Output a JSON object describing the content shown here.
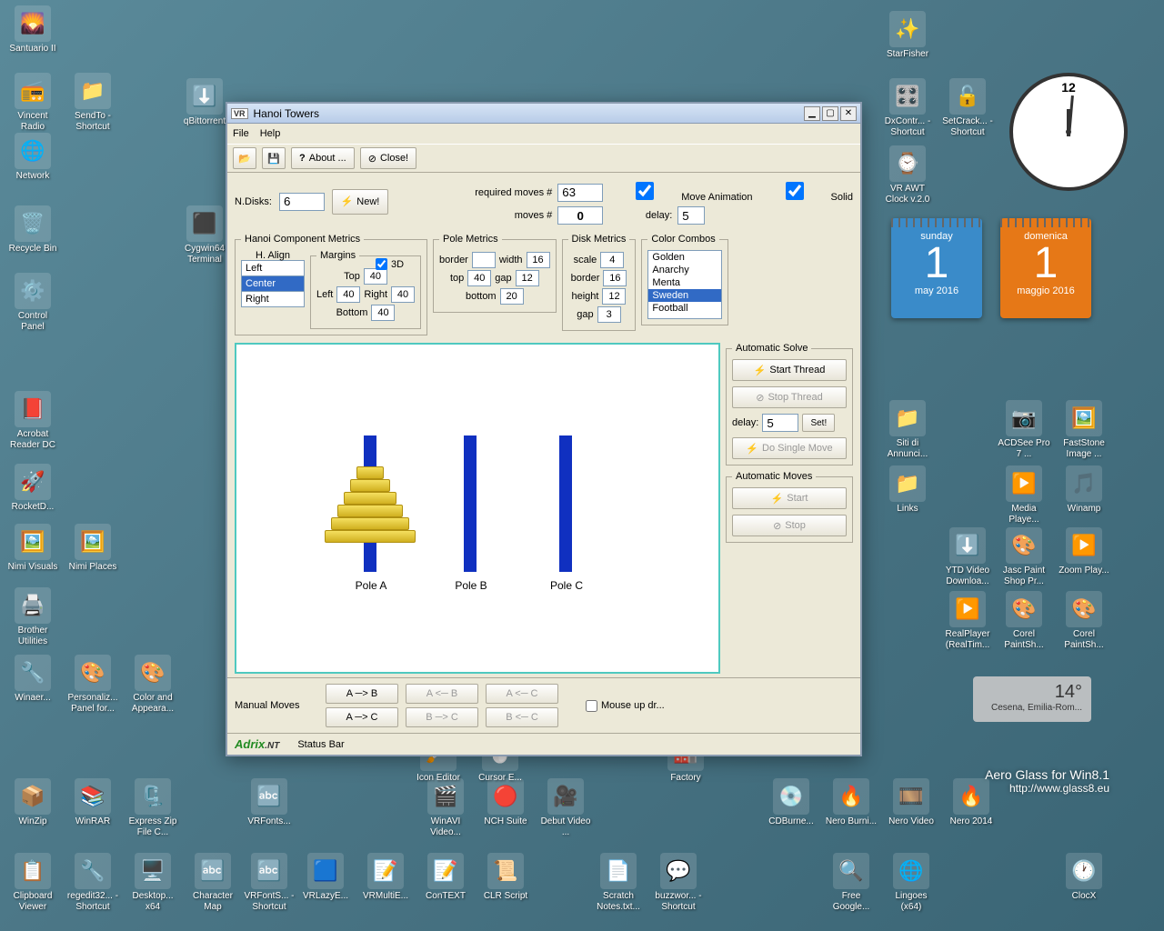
{
  "window": {
    "title": "Hanoi Towers",
    "menu": {
      "file": "File",
      "help": "Help"
    },
    "toolbar": {
      "about": "About ...",
      "close": "Close!"
    },
    "ndisks_label": "N.Disks:",
    "ndisks": "6",
    "new_btn": "New!",
    "reqmoves_label": "required moves #",
    "reqmoves": "63",
    "moves_label": "moves #",
    "moves": "0",
    "moveanim": "Move Animation",
    "solid": "Solid",
    "delay_label": "delay:",
    "delay": "5",
    "hcm_legend": "Hanoi Component Metrics",
    "threed": "3D",
    "halign_legend": "H. Align",
    "halign": {
      "left": "Left",
      "center": "Center",
      "right": "Right"
    },
    "margins_legend": "Margins",
    "margins": {
      "top_l": "Top",
      "top": "40",
      "left_l": "Left",
      "left": "40",
      "right_l": "Right",
      "right": "40",
      "bottom_l": "Bottom",
      "bottom": "40"
    },
    "pole_legend": "Pole Metrics",
    "pole": {
      "border_l": "border",
      "border": "",
      "width_l": "width",
      "width": "16",
      "top_l": "top",
      "top": "40",
      "gap_l": "gap",
      "gap": "12",
      "bottom_l": "bottom",
      "bottom": "20"
    },
    "disk_legend": "Disk Metrics",
    "disk": {
      "scale_l": "scale",
      "scale": "4",
      "border_l": "border",
      "border": "16",
      "height_l": "height",
      "height": "12",
      "gap_l": "gap",
      "gap": "3"
    },
    "color_legend": "Color Combos",
    "colors": {
      "c0": "Golden",
      "c1": "Anarchy",
      "c2": "Menta",
      "c3": "Sweden",
      "c4": "Football"
    },
    "poleA": "Pole A",
    "poleB": "Pole B",
    "poleC": "Pole C",
    "auto_legend": "Automatic Solve",
    "auto": {
      "start": "Start Thread",
      "stop": "Stop Thread",
      "delay_l": "delay:",
      "delay": "5",
      "set": "Set!",
      "single": "Do Single Move"
    },
    "automoves_legend": "Automatic Moves",
    "automoves": {
      "start": "Start",
      "stop": "Stop"
    },
    "manual_label": "Manual Moves",
    "moves_btns": {
      "ab": "A ─> B",
      "ba": "A <─ B",
      "ca": "A <─ C",
      "ac": "A ─> C",
      "bc": "B ─> C",
      "cb": "B <─ C"
    },
    "mouseup": "Mouse up dr...",
    "status": {
      "brand": "Adrix",
      "nt": ".NT",
      "text": "Status Bar"
    }
  },
  "gadgets": {
    "cal_blue": {
      "day": "sunday",
      "num": "1",
      "mon": "may 2016"
    },
    "cal_orange": {
      "day": "domenica",
      "num": "1",
      "mon": "maggio 2016"
    },
    "weather": {
      "temp": "14°",
      "loc": "Cesena, Emilia-Rom..."
    },
    "aero": {
      "t1": "Aero Glass for Win8.1",
      "t2": "http://www.glass8.eu"
    }
  },
  "icons": {
    "i0": "Santuario II",
    "i1": "Vincent Radio",
    "i2": "SendTo - Shortcut",
    "i3": "Network",
    "i4": "Recycle Bin",
    "i5": "Control Panel",
    "i6": "Acrobat Reader DC",
    "i7": "RocketD...",
    "i8": "Nimi Visuals",
    "i9": "Nimi Places",
    "i10": "Brother Utilities",
    "i11": "Winaer...",
    "i12": "Personaliz... Panel for...",
    "i13": "Color and Appeara...",
    "i14": "qBittorrent",
    "i15": "Cygwin64 Terminal",
    "i16": "StarFisher",
    "i17": "DxContr... - Shortcut",
    "i18": "SetCrack... - Shortcut",
    "i19": "VR AWT Clock v.2.0",
    "i20": "Siti di Annunci...",
    "i21": "Links",
    "i22": "ACDSee Pro 7 ...",
    "i23": "FastStone Image ...",
    "i24": "Media Playe...",
    "i25": "Winamp",
    "i26": "YTD Video Downloa...",
    "i27": "Jasc Paint Shop Pr...",
    "i28": "Zoom Play...",
    "i29": "RealPlayer (RealTim...",
    "i30": "Corel PaintSh...",
    "i31": "Corel PaintSh...",
    "i32": "WinZip",
    "i33": "WinRAR",
    "i34": "Express Zip File C...",
    "i35": "VRFonts...",
    "i36": "WinAVI Video...",
    "i37": "NCH Suite",
    "i38": "Debut Video ...",
    "i39": "CDBurne...",
    "i40": "Nero Burni...",
    "i41": "Nero Video",
    "i42": "Nero 2014",
    "i43": "Clipboard Viewer",
    "i44": "regedit32... - Shortcut",
    "i45": "Desktop... x64",
    "i46": "Character Map",
    "i47": "VRFontS... - Shortcut",
    "i48": "VRLazyE...",
    "i49": "VRMultiE...",
    "i50": "ConTEXT",
    "i51": "CLR Script",
    "i52": "Scratch Notes.txt...",
    "i53": "buzzwor... - Shortcut",
    "i54": "Free Google...",
    "i55": "Lingoes (x64)",
    "i56": "ClocX",
    "i57": "Factory",
    "i58": "Icon Editor",
    "i59": "Cursor E..."
  }
}
